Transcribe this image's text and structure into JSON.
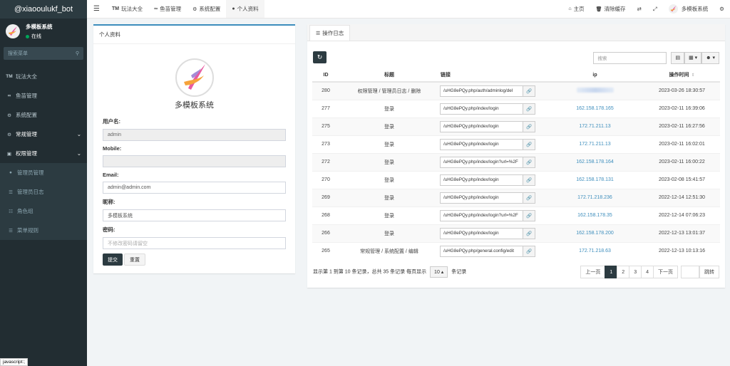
{
  "app": {
    "brand": "@xiaooulukf_bot"
  },
  "user": {
    "name": "多模板系统",
    "status": "在线"
  },
  "sidebar": {
    "search_placeholder": "搜索菜单",
    "items": [
      {
        "icon": "TM",
        "label": "玩法大全"
      },
      {
        "icon": "∞",
        "label": "鱼苗管理"
      },
      {
        "icon": "⚙",
        "label": "系统配置"
      },
      {
        "icon": "⚙",
        "label": "常规管理"
      },
      {
        "icon": "▣",
        "label": "权限管理"
      }
    ],
    "subitems": [
      {
        "icon": "●",
        "label": "管理员管理"
      },
      {
        "icon": "☰",
        "label": "管理员日志"
      },
      {
        "icon": "☷",
        "label": "角色组"
      },
      {
        "icon": "☰",
        "label": "菜单规则"
      }
    ]
  },
  "topbar": {
    "tabs": [
      {
        "icon": "TM",
        "label": "玩法大全"
      },
      {
        "icon": "∞",
        "label": "鱼苗管理"
      },
      {
        "icon": "⚙",
        "label": "系统配置"
      },
      {
        "icon": "●",
        "label": "个人资料"
      }
    ],
    "right": [
      {
        "icon": "⌂",
        "label": "主页"
      },
      {
        "icon": "🗑",
        "label": "清除缓存"
      }
    ],
    "account_name": "多模板系统"
  },
  "profile": {
    "header": "个人资料",
    "site_name": "多模板系统",
    "fields": {
      "username_label": "用户名:",
      "username_value": "admin",
      "mobile_label": "Mobile:",
      "mobile_value": "",
      "email_label": "Email:",
      "email_value": "admin@admin.com",
      "nickname_label": "昵称:",
      "nickname_value": "多模板系统",
      "password_label": "密码:",
      "password_placeholder": "不修改密码请留空"
    },
    "submit_label": "提交",
    "reset_label": "重置"
  },
  "log": {
    "tab_label": "操作日志",
    "search_placeholder": "搜索",
    "columns": {
      "id": "ID",
      "title": "标题",
      "url": "链接",
      "ip": "ip",
      "time": "操作时间"
    },
    "rows": [
      {
        "id": "280",
        "title": "权限管理 / 管理员日志 / 删除",
        "url": "/uHG8ePQy.php/auth/adminlog/del",
        "ip": "",
        "time": "2023-03-26 18:30:57"
      },
      {
        "id": "277",
        "title": "登录",
        "url": "/uHG8ePQy.php/index/login",
        "ip": "162.158.178.165",
        "time": "2023-02-11 16:39:06"
      },
      {
        "id": "275",
        "title": "登录",
        "url": "/uHG8ePQy.php/index/login",
        "ip": "172.71.211.13",
        "time": "2023-02-11 16:27:56"
      },
      {
        "id": "273",
        "title": "登录",
        "url": "/uHG8ePQy.php/index/login",
        "ip": "172.71.211.13",
        "time": "2023-02-11 16:02:01"
      },
      {
        "id": "272",
        "title": "登录",
        "url": "/uHG8ePQy.php/index/login?url=%2F",
        "ip": "162.158.178.164",
        "time": "2023-02-11 16:00:22"
      },
      {
        "id": "270",
        "title": "登录",
        "url": "/uHG8ePQy.php/index/login",
        "ip": "162.158.178.131",
        "time": "2023-02-08 15:41:57"
      },
      {
        "id": "269",
        "title": "登录",
        "url": "/uHG8ePQy.php/index/login",
        "ip": "172.71.218.236",
        "time": "2022-12-14 12:51:30"
      },
      {
        "id": "268",
        "title": "登录",
        "url": "/uHG8ePQy.php/index/login?url=%2F",
        "ip": "162.158.178.35",
        "time": "2022-12-14 07:06:23"
      },
      {
        "id": "266",
        "title": "登录",
        "url": "/uHG8ePQy.php/index/login",
        "ip": "162.158.178.200",
        "time": "2022-12-13 13:01:37"
      },
      {
        "id": "265",
        "title": "常规管理 / 系统配置 / 编辑",
        "url": "/uHG8ePQy.php/general.config/edit",
        "ip": "172.71.218.63",
        "time": "2022-12-13 10:13:16"
      }
    ],
    "footer": {
      "summary": "显示第 1 到第 10 条记录，总共 35 条记录 每页显示",
      "page_size": "10",
      "per_page_suffix": "条记录"
    },
    "pager": {
      "prev": "上一页",
      "pages": [
        "1",
        "2",
        "3",
        "4"
      ],
      "active": "1",
      "next": "下一页",
      "jump": "跳转"
    }
  },
  "status_bar": "javascript:;"
}
